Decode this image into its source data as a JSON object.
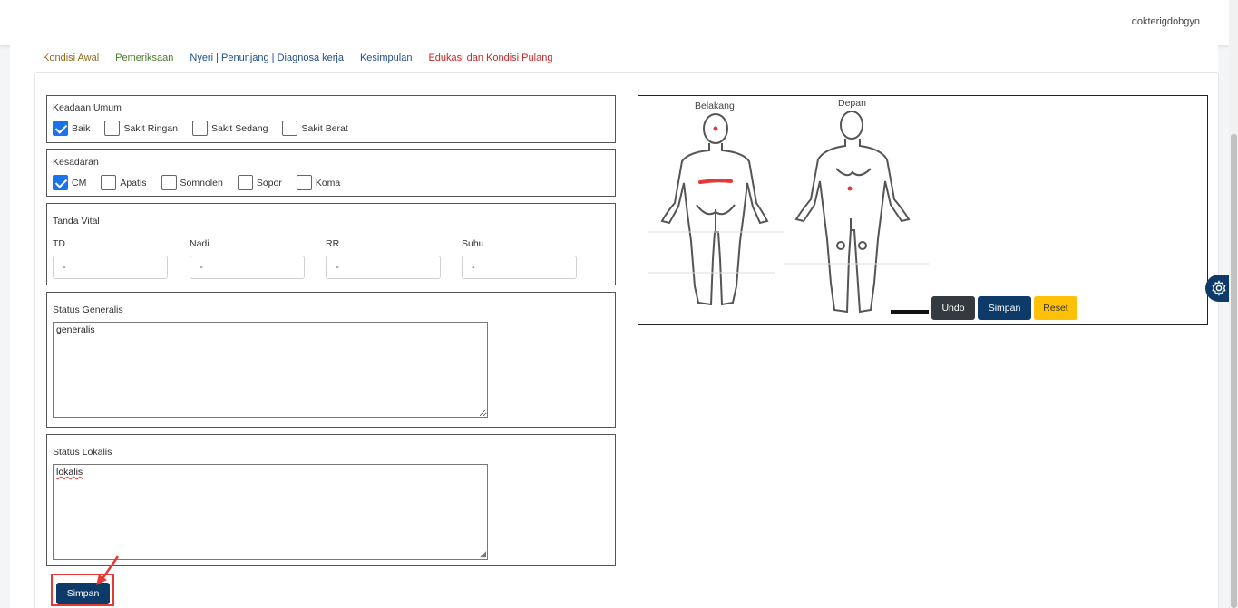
{
  "header": {
    "user": "dokterigdobgyn"
  },
  "tabs": [
    {
      "label": "Kondisi Awal",
      "color": "#8a6a1a"
    },
    {
      "label": "Pemeriksaan",
      "color": "#4a7a2a"
    },
    {
      "label": "Nyeri | Penunjang | Diagnosa kerja",
      "color": "#1f4f8a"
    },
    {
      "label": "Kesimpulan",
      "color": "#1f4f8a"
    },
    {
      "label": "Edukasi dan Kondisi Pulang",
      "color": "#c62828"
    }
  ],
  "keadaan_umum": {
    "title": "Keadaan Umum",
    "options": [
      {
        "label": "Baik",
        "checked": true
      },
      {
        "label": "Sakit Ringan",
        "checked": false
      },
      {
        "label": "Sakit Sedang",
        "checked": false
      },
      {
        "label": "Sakit Berat",
        "checked": false
      }
    ]
  },
  "kesadaran": {
    "title": "Kesadaran",
    "options": [
      {
        "label": "CM",
        "checked": true
      },
      {
        "label": "Apatis",
        "checked": false
      },
      {
        "label": "Somnolen",
        "checked": false
      },
      {
        "label": "Sopor",
        "checked": false
      },
      {
        "label": "Koma",
        "checked": false
      }
    ]
  },
  "tanda_vital": {
    "title": "Tanda Vital",
    "fields": [
      {
        "label": "TD",
        "value": "-"
      },
      {
        "label": "Nadi",
        "value": "-"
      },
      {
        "label": "RR",
        "value": "-"
      },
      {
        "label": "Suhu",
        "value": "-"
      }
    ]
  },
  "status_generalis": {
    "title": "Status Generalis",
    "value": "generalis"
  },
  "status_lokalis": {
    "title": "Status Lokalis",
    "value": "lokalis"
  },
  "body_map": {
    "label_back": "Belakang",
    "label_front": "Depan",
    "undo_label": "Undo",
    "save_label": "Simpan",
    "reset_label": "Reset"
  },
  "footer": {
    "save_label": "Simpan"
  },
  "colors": {
    "accent": "#0e3a69",
    "check": "#1a73e8",
    "mark": "#e53935",
    "warning": "#ffc107"
  }
}
